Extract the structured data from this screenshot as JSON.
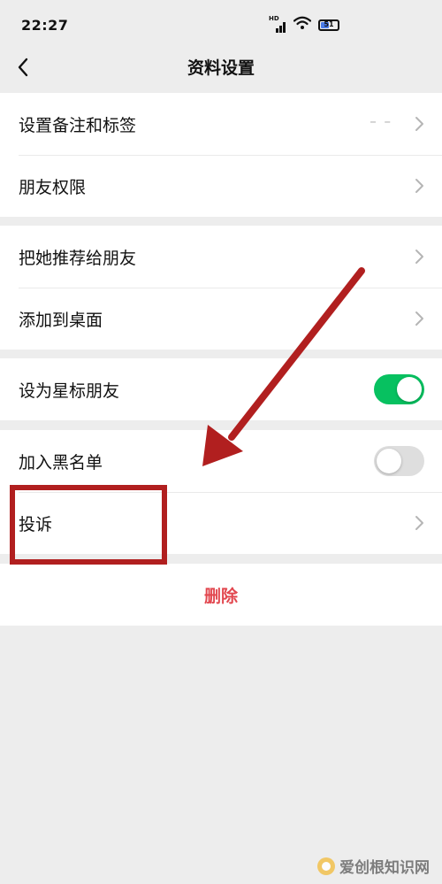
{
  "status_bar": {
    "time": "22:27",
    "signal_label": "HD",
    "battery_level": "51"
  },
  "nav": {
    "title": "资料设置"
  },
  "groups": {
    "remark": {
      "set_remark_label": "设置备注和标签",
      "set_remark_value": "– –",
      "permissions_label": "朋友权限"
    },
    "share": {
      "recommend_label": "把她推荐给朋友",
      "add_to_desktop_label": "添加到桌面"
    },
    "star": {
      "label": "设为星标朋友",
      "enabled": true
    },
    "block": {
      "blacklist_label": "加入黑名单",
      "blacklist_enabled": false,
      "complain_label": "投诉"
    },
    "delete": {
      "label": "删除"
    }
  },
  "colors": {
    "toggle_on": "#07c160",
    "delete_text": "#e2474f",
    "annotation": "#b11f1f"
  },
  "watermark": {
    "text": "爱创根知识网"
  }
}
